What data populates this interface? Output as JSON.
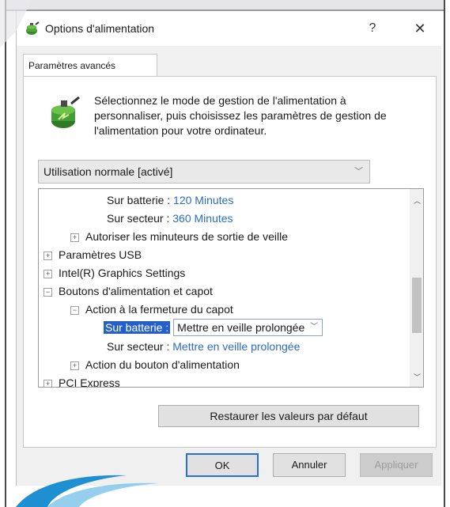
{
  "window": {
    "title": "Options d'alimentation",
    "help_label": "?",
    "close_label": "✕"
  },
  "tab": {
    "label": "Paramètres avancés"
  },
  "description": "Sélectionnez le mode de gestion de l'alimentation à personnaliser, puis choisissez les paramètres de gestion de l'alimentation pour votre ordinateur.",
  "plan_select": {
    "value": "Utilisation normale [activé]"
  },
  "tree": {
    "rows": [
      {
        "label": "Sur batterie :",
        "value": "120 Minutes"
      },
      {
        "label": "Sur secteur :",
        "value": "360 Minutes"
      },
      {
        "expander": "+",
        "label": "Autoriser les minuteurs de sortie de veille"
      },
      {
        "expander": "+",
        "label": "Paramètres USB"
      },
      {
        "expander": "+",
        "label": "Intel(R) Graphics Settings"
      },
      {
        "expander": "−",
        "label": "Boutons d'alimentation et capot"
      },
      {
        "expander": "−",
        "label": "Action à la fermeture du capot"
      },
      {
        "label": "Sur batterie :",
        "value": "Mettre en veille prolongée"
      },
      {
        "label": "Sur secteur :",
        "value": "Mettre en veille prolongée"
      },
      {
        "expander": "+",
        "label": "Action du bouton d'alimentation"
      },
      {
        "expander": "+",
        "label": "PCI Express"
      }
    ]
  },
  "buttons": {
    "restore": "Restaurer les valeurs par défaut",
    "ok": "OK",
    "cancel": "Annuler",
    "apply": "Appliquer"
  },
  "colors": {
    "selection": "#2560c8",
    "value_text": "#2b6cc4",
    "dialog_bg": "#f0f0f0"
  },
  "icons": {
    "app": "power-plan-icon",
    "header": "power-plan-large-icon"
  }
}
